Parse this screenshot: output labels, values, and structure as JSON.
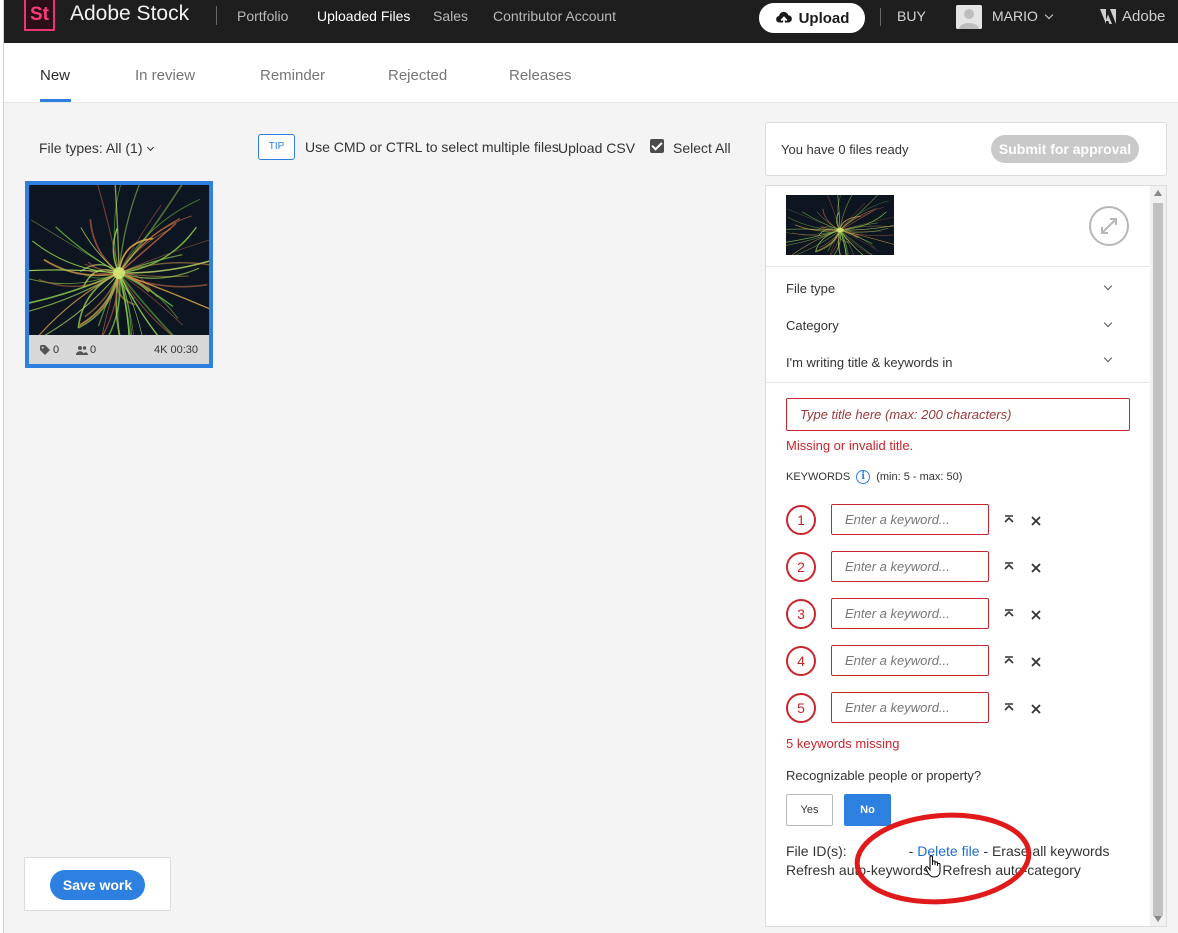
{
  "header": {
    "logo": "St",
    "brand": "Adobe Stock",
    "nav": [
      "Portfolio",
      "Uploaded Files",
      "Sales",
      "Contributor Account"
    ],
    "upload_label": "Upload",
    "buy_label": "BUY",
    "user_name": "MARIO",
    "adobe_label": "Adobe"
  },
  "tabs": [
    "New",
    "In review",
    "Reminder",
    "Rejected",
    "Releases"
  ],
  "toolbar": {
    "file_types": "File types: All (1)",
    "tip": "TIP",
    "tip_text": "Use CMD or CTRL to select multiple files",
    "upload_csv": "Upload CSV",
    "select_all": "Select All"
  },
  "thumbnail": {
    "keywords_count": "0",
    "people_count": "0",
    "resolution_duration": "4K 00:30"
  },
  "ready": {
    "text": "You have 0 files ready",
    "submit_label": "Submit for approval"
  },
  "panel": {
    "dropdowns": [
      "File type",
      "Category",
      "I'm writing title & keywords in"
    ],
    "title_placeholder": "Type title here (max: 200 characters)",
    "title_error": "Missing or invalid title.",
    "keywords_label": "KEYWORDS",
    "keywords_range": "(min: 5 - max: 50)",
    "keyword_numbers": [
      "1",
      "2",
      "3",
      "4",
      "5"
    ],
    "keyword_placeholder": "Enter a keyword...",
    "keywords_error": "5 keywords missing",
    "people_question": "Recognizable people or property?",
    "yes_label": "Yes",
    "no_label": "No",
    "file_id_label": "File ID(s):",
    "delete_file": "Delete file",
    "erase_keywords": "Erase all keywords",
    "refresh_keywords": "Refresh auto-keywords",
    "refresh_category": "Refresh auto-category"
  },
  "save_label": "Save work",
  "colors": {
    "accent": "#2d7fe0",
    "error": "#c9252c",
    "topbar": "#1e1e1e",
    "annotation": "#e01a1a"
  }
}
